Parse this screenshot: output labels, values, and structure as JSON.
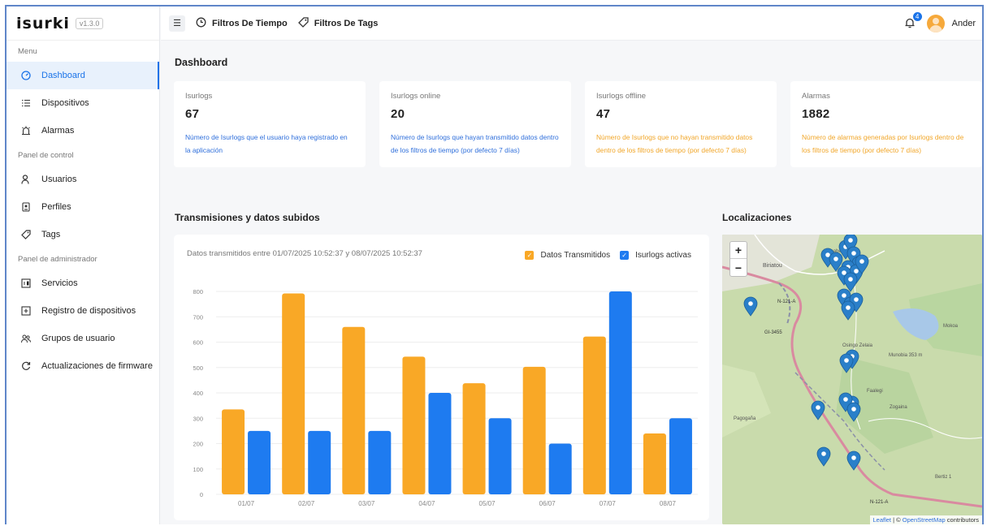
{
  "app": {
    "logo": "isurki",
    "version": "v1.3.0"
  },
  "sidebar": {
    "sections": [
      {
        "title": "Menu",
        "items": [
          {
            "label": "Dashboard",
            "icon": "dashboard-gauge-icon",
            "active": true
          },
          {
            "label": "Dispositivos",
            "icon": "list-icon"
          },
          {
            "label": "Alarmas",
            "icon": "alarm-icon"
          }
        ]
      },
      {
        "title": "Panel de control",
        "items": [
          {
            "label": "Usuarios",
            "icon": "user-icon"
          },
          {
            "label": "Perfiles",
            "icon": "profile-card-icon"
          },
          {
            "label": "Tags",
            "icon": "tag-icon"
          }
        ]
      },
      {
        "title": "Panel de administrador",
        "items": [
          {
            "label": "Servicios",
            "icon": "services-icon"
          },
          {
            "label": "Registro de dispositivos",
            "icon": "plus-box-icon"
          },
          {
            "label": "Grupos de usuario",
            "icon": "users-group-icon"
          },
          {
            "label": "Actualizaciones de firmware",
            "icon": "refresh-icon"
          }
        ]
      }
    ]
  },
  "topbar": {
    "time_filter": "Filtros De Tiempo",
    "tag_filter": "Filtros De Tags",
    "notification_count": "4",
    "username": "Ander"
  },
  "page_title": "Dashboard",
  "stats": [
    {
      "label": "Isurlogs",
      "value": "67",
      "desc": "Número de Isurlogs que el usuario haya registrado en la aplicación",
      "color": "blue"
    },
    {
      "label": "Isurlogs online",
      "value": "20",
      "desc": "Número de Isurlogs que hayan transmitido datos dentro de los filtros de tiempo (por defecto 7 días)",
      "color": "blue"
    },
    {
      "label": "Isurlogs offline",
      "value": "47",
      "desc": "Número de Isurlogs que no hayan transmitido datos dentro de los filtros de tiempo (por defecto 7 días)",
      "color": "orange"
    },
    {
      "label": "Alarmas",
      "value": "1882",
      "desc": "Número de alarmas generadas por Isurlogs dentro de los filtros de tiempo (por defecto 7 días)",
      "color": "orange"
    }
  ],
  "chart_section_title": "Transmisiones y datos subidos",
  "map_section_title": "Localizaciones",
  "colors": {
    "orange": "#F9A826",
    "blue": "#1E7BF0",
    "accent": "#1a73e8"
  },
  "chart_data": {
    "type": "bar",
    "subtitle": "Datos transmitidos entre 01/07/2025 10:52:37 y 08/07/2025 10:52:37",
    "categories": [
      "01/07",
      "02/07",
      "03/07",
      "04/07",
      "05/07",
      "06/07",
      "07/07",
      "08/07"
    ],
    "series": [
      {
        "name": "Datos Transmitidos",
        "color": "#F9A826",
        "values": [
          335,
          792,
          660,
          543,
          438,
          503,
          622,
          240
        ]
      },
      {
        "name": "Isurlogs activas",
        "color": "#1E7BF0",
        "values": [
          250,
          250,
          250,
          400,
          300,
          200,
          800,
          300
        ]
      }
    ],
    "yticks": [
      0,
      100,
      200,
      300,
      400,
      500,
      600,
      700,
      800
    ],
    "ylim": [
      0,
      800
    ],
    "legend_position": "top-right",
    "grid": true
  },
  "map": {
    "zoom_in": "+",
    "zoom_out": "−",
    "attribution_leaflet": "Leaflet",
    "attribution_sep": " | © ",
    "attribution_osm": "OpenStreetMap",
    "attribution_rest": " contributors",
    "labels": [
      "Biriatou",
      "Lumaberde",
      "N-121-A",
      "GI-3455",
      "Osingo Zelaia",
      "Munobia 353 m",
      "Mokoa",
      "Faalegi",
      "Pagogaña",
      "Zogaina",
      "Bertiz 1",
      "N-121-A"
    ]
  }
}
